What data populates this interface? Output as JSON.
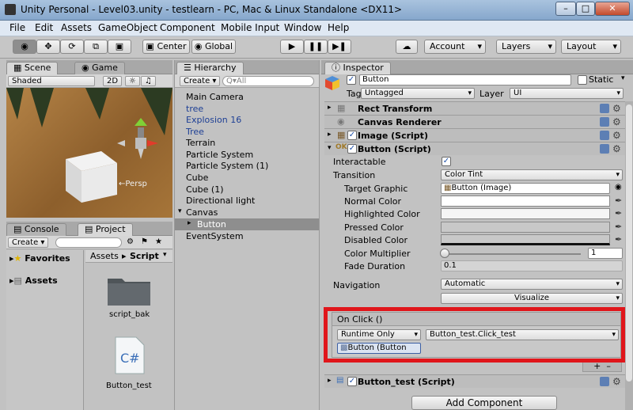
{
  "window": {
    "title": "Unity Personal - Level03.unity - testlearn - PC, Mac & Linux Standalone <DX11>"
  },
  "menu": [
    "File",
    "Edit",
    "Assets",
    "GameObject",
    "Component",
    "Mobile Input",
    "Window",
    "Help"
  ],
  "toolbar": {
    "center": "Center",
    "global": "Global",
    "account": "Account",
    "layers": "Layers",
    "layout": "Layout"
  },
  "scene": {
    "tab_scene": "Scene",
    "tab_game": "Game",
    "shaded": "Shaded",
    "mode2d": "2D",
    "persp": "←Persp"
  },
  "hierarchy": {
    "tab": "Hierarchy",
    "create": "Create",
    "search": "Q▾All",
    "items": [
      "Main Camera",
      "tree",
      "Explosion 16",
      "Tree",
      "Terrain",
      "Particle System",
      "Particle System (1)",
      "Cube",
      "Cube (1)",
      "Directional light",
      "Canvas",
      "Button",
      "EventSystem"
    ]
  },
  "project": {
    "tab_console": "Console",
    "tab_project": "Project",
    "create": "Create",
    "favorites": "Favorites",
    "assets": "Assets",
    "breadcrumb_assets": "Assets",
    "breadcrumb_script": "Script",
    "files": [
      "script_bak",
      "Button_test"
    ]
  },
  "inspector": {
    "tab": "Inspector",
    "name": "Button",
    "static": "Static",
    "tag_label": "Tag",
    "tag": "Untagged",
    "layer_label": "Layer",
    "layer": "UI",
    "components": [
      "Rect Transform",
      "Canvas Renderer",
      "Image (Script)",
      "Button (Script)"
    ],
    "props": {
      "interactable": "Interactable",
      "transition": "Transition",
      "transition_val": "Color Tint",
      "target_graphic": "Target Graphic",
      "target_graphic_val": "Button (Image)",
      "normal": "Normal Color",
      "highlighted": "Highlighted Color",
      "pressed": "Pressed Color",
      "disabled": "Disabled Color",
      "multiplier": "Color Multiplier",
      "multiplier_val": "1",
      "fade": "Fade Duration",
      "fade_val": "0.1",
      "navigation": "Navigation",
      "navigation_val": "Automatic",
      "visualize": "Visualize"
    },
    "onclick": {
      "title": "On Click ()",
      "runtime": "Runtime Only",
      "function": "Button_test.Click_test",
      "object": "Button (Button"
    },
    "footer_component": "Button_test (Script)",
    "add_component": "Add Component"
  },
  "colors": {
    "highlight_box": "#e0161b",
    "accent_blue": "#1d3f95"
  }
}
